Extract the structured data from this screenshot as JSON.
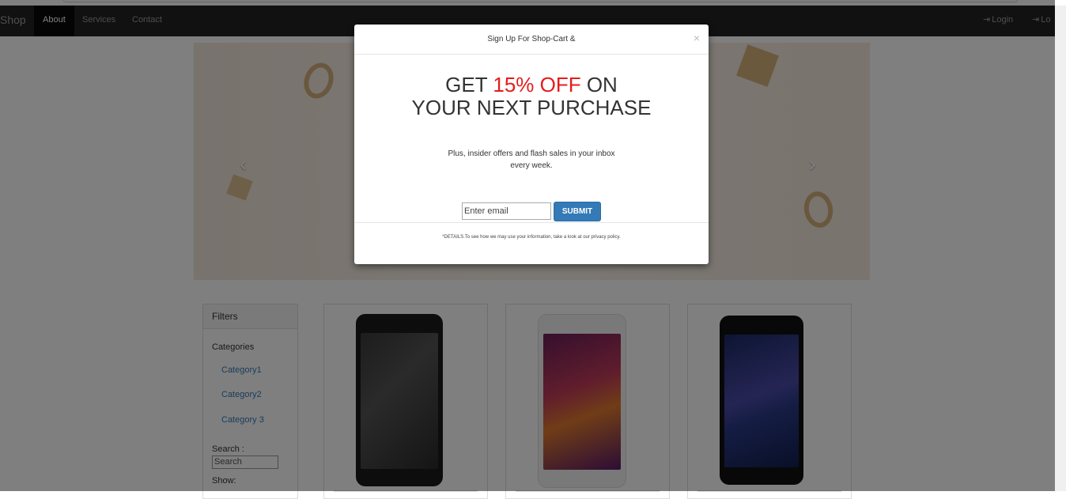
{
  "navbar": {
    "brand": "Shop",
    "items": [
      {
        "label": "About",
        "active": true
      },
      {
        "label": "Services",
        "active": false
      },
      {
        "label": "Contact",
        "active": false
      }
    ],
    "login_label": "Login",
    "logout_label": "Lo"
  },
  "filters": {
    "title": "Filters",
    "categories_label": "Categories",
    "categories": [
      "Category1",
      "Category2",
      "Category 3"
    ],
    "search_label": "Search :",
    "search_placeholder": "Search",
    "show_label": "Show:"
  },
  "modal": {
    "title": "Sign Up For Shop-Cart &",
    "close_glyph": "×",
    "headline_prefix": "GET ",
    "headline_highlight": "15% OFF",
    "headline_suffix": " ON",
    "headline_line2": "YOUR NEXT PURCHASE",
    "subtext_line1": "Plus, insider offers and flash sales in your inbox",
    "subtext_line2": "every week.",
    "email_placeholder": "Enter email",
    "submit_label": "SUBMIT",
    "details": "*DETAILS.To see how we may use your information, take a look at our privacy policy."
  },
  "carousel": {
    "prev_icon": "chevron-left-icon",
    "next_icon": "chevron-right-icon"
  },
  "products": [
    {
      "name": "phone-black",
      "body": "#1a1a1a"
    },
    {
      "name": "phone-white",
      "body": "#f2f2f2"
    },
    {
      "name": "phone-dark",
      "body": "#111111"
    }
  ],
  "colors": {
    "accent": "#337ab7",
    "highlight": "#e51c1c",
    "navbar": "#222222"
  }
}
